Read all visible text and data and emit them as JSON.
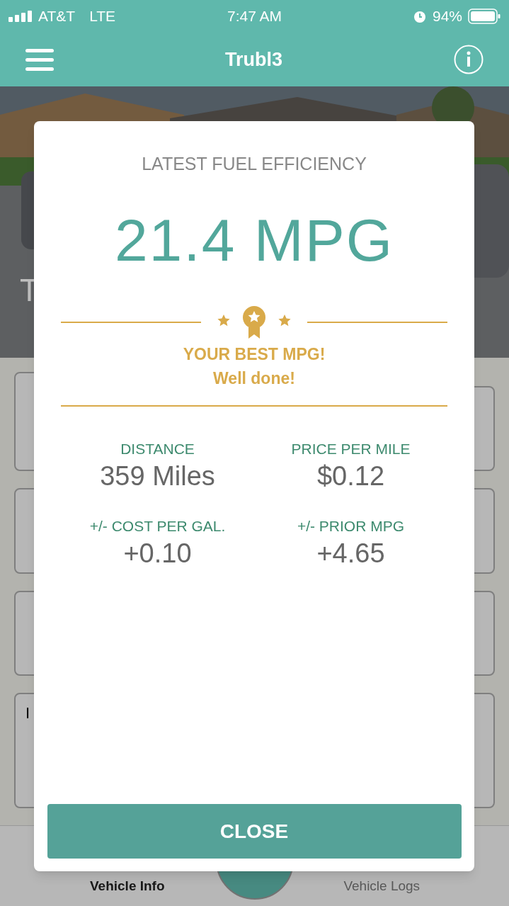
{
  "status_bar": {
    "carrier": "AT&T",
    "network": "LTE",
    "time": "7:47 AM",
    "battery": "94%"
  },
  "header": {
    "title": "Trubl3"
  },
  "background": {
    "photo_text": "T",
    "card_text": "I"
  },
  "tab_bar": [
    {
      "label": "Vehicle Info",
      "selected": true
    },
    {
      "label": "Vehicle Logs",
      "selected": false
    }
  ],
  "modal": {
    "title": "LATEST FUEL EFFICIENCY",
    "value": "21.4 MPG",
    "award": {
      "line1": "YOUR BEST MPG!",
      "line2": "Well done!"
    },
    "stats": [
      {
        "label": "DISTANCE",
        "value": "359 Miles"
      },
      {
        "label": "PRICE PER MILE",
        "value": "$0.12"
      },
      {
        "label": "+/- COST PER GAL.",
        "value": "+0.10"
      },
      {
        "label": "+/- PRIOR MPG",
        "value": "+4.65"
      }
    ],
    "button": "CLOSE"
  }
}
